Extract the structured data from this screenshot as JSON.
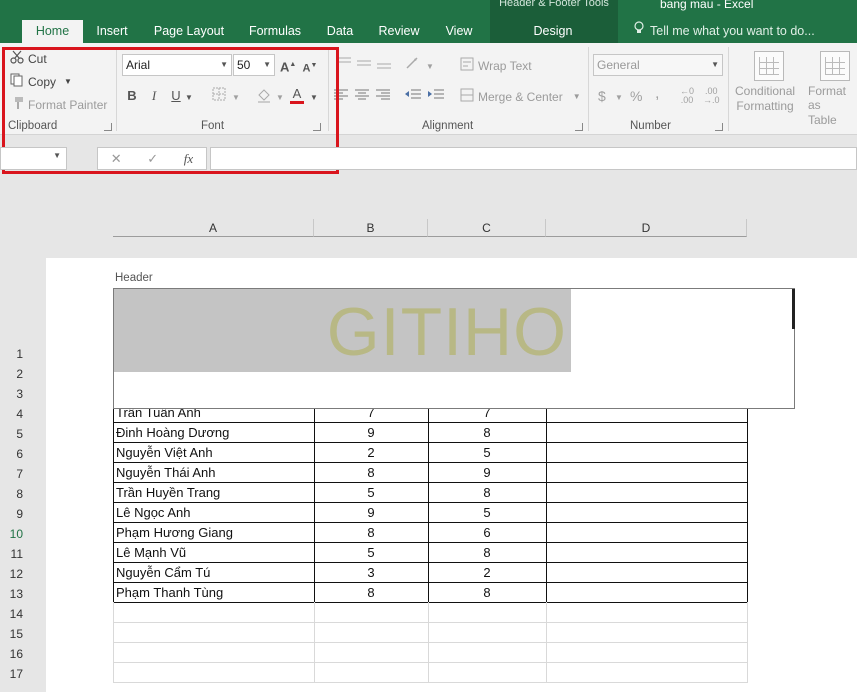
{
  "title_bar": {
    "context_title": "Header & Footer Tools",
    "app_title": "bang mau - Excel",
    "tabs": [
      {
        "label": "Home",
        "active": true
      },
      {
        "label": "Insert"
      },
      {
        "label": "Page Layout"
      },
      {
        "label": "Formulas"
      },
      {
        "label": "Data"
      },
      {
        "label": "Review"
      },
      {
        "label": "View"
      },
      {
        "label": "Design"
      }
    ],
    "tell_me": "Tell me what you want to do..."
  },
  "ribbon": {
    "clipboard": {
      "cut": "Cut",
      "copy": "Copy",
      "format_painter": "Format Painter",
      "label": "Clipboard"
    },
    "font": {
      "font_name": "Arial",
      "font_size": "50",
      "label": "Font",
      "bold": "B",
      "italic": "I",
      "underline": "U",
      "font_color_glyph": "A"
    },
    "alignment": {
      "wrap_text": "Wrap Text",
      "merge_center": "Merge & Center",
      "label": "Alignment"
    },
    "number": {
      "format": "General",
      "currency": "$",
      "percent": "%",
      "comma": ",",
      "label": "Number"
    },
    "styles": {
      "conditional_formatting": [
        "Conditional",
        "Formatting"
      ],
      "format_as_table": [
        "Format as",
        "Table"
      ]
    }
  },
  "formula_bar": {
    "cancel": "✕",
    "enter": "✓",
    "fx": "fx"
  },
  "columns": [
    "A",
    "B",
    "C",
    "D"
  ],
  "page": {
    "header_label": "Header",
    "watermark_text": "GITIHO"
  },
  "rows": [
    {
      "num": "1"
    },
    {
      "num": "2"
    },
    {
      "num": "3"
    },
    {
      "num": "4",
      "name": "Trần Tuấn Anh",
      "b": "7",
      "c": "7"
    },
    {
      "num": "5",
      "name": "Đinh Hoàng Dương",
      "b": "9",
      "c": "8"
    },
    {
      "num": "6",
      "name": "Nguyễn Việt Anh",
      "b": "2",
      "c": "5"
    },
    {
      "num": "7",
      "name": "Nguyễn Thái Anh",
      "b": "8",
      "c": "9"
    },
    {
      "num": "8",
      "name": "Trần Huyền Trang",
      "b": "5",
      "c": "8"
    },
    {
      "num": "9",
      "name": "Lê Ngọc Anh",
      "b": "9",
      "c": "5"
    },
    {
      "num": "10",
      "name": "Phạm Hương Giang",
      "b": "8",
      "c": "6",
      "active": true
    },
    {
      "num": "11",
      "name": "Lê Mạnh Vũ",
      "b": "5",
      "c": "8"
    },
    {
      "num": "12",
      "name": "Nguyễn Cẩm Tú",
      "b": "3",
      "c": "2"
    },
    {
      "num": "13",
      "name": "Phạm Thanh Tùng",
      "b": "8",
      "c": "8"
    },
    {
      "num": "14"
    },
    {
      "num": "15"
    },
    {
      "num": "16"
    },
    {
      "num": "17"
    }
  ],
  "colors": {
    "excel_green": "#217346",
    "highlight_red": "#d9151d",
    "watermark": "#b8b885"
  }
}
